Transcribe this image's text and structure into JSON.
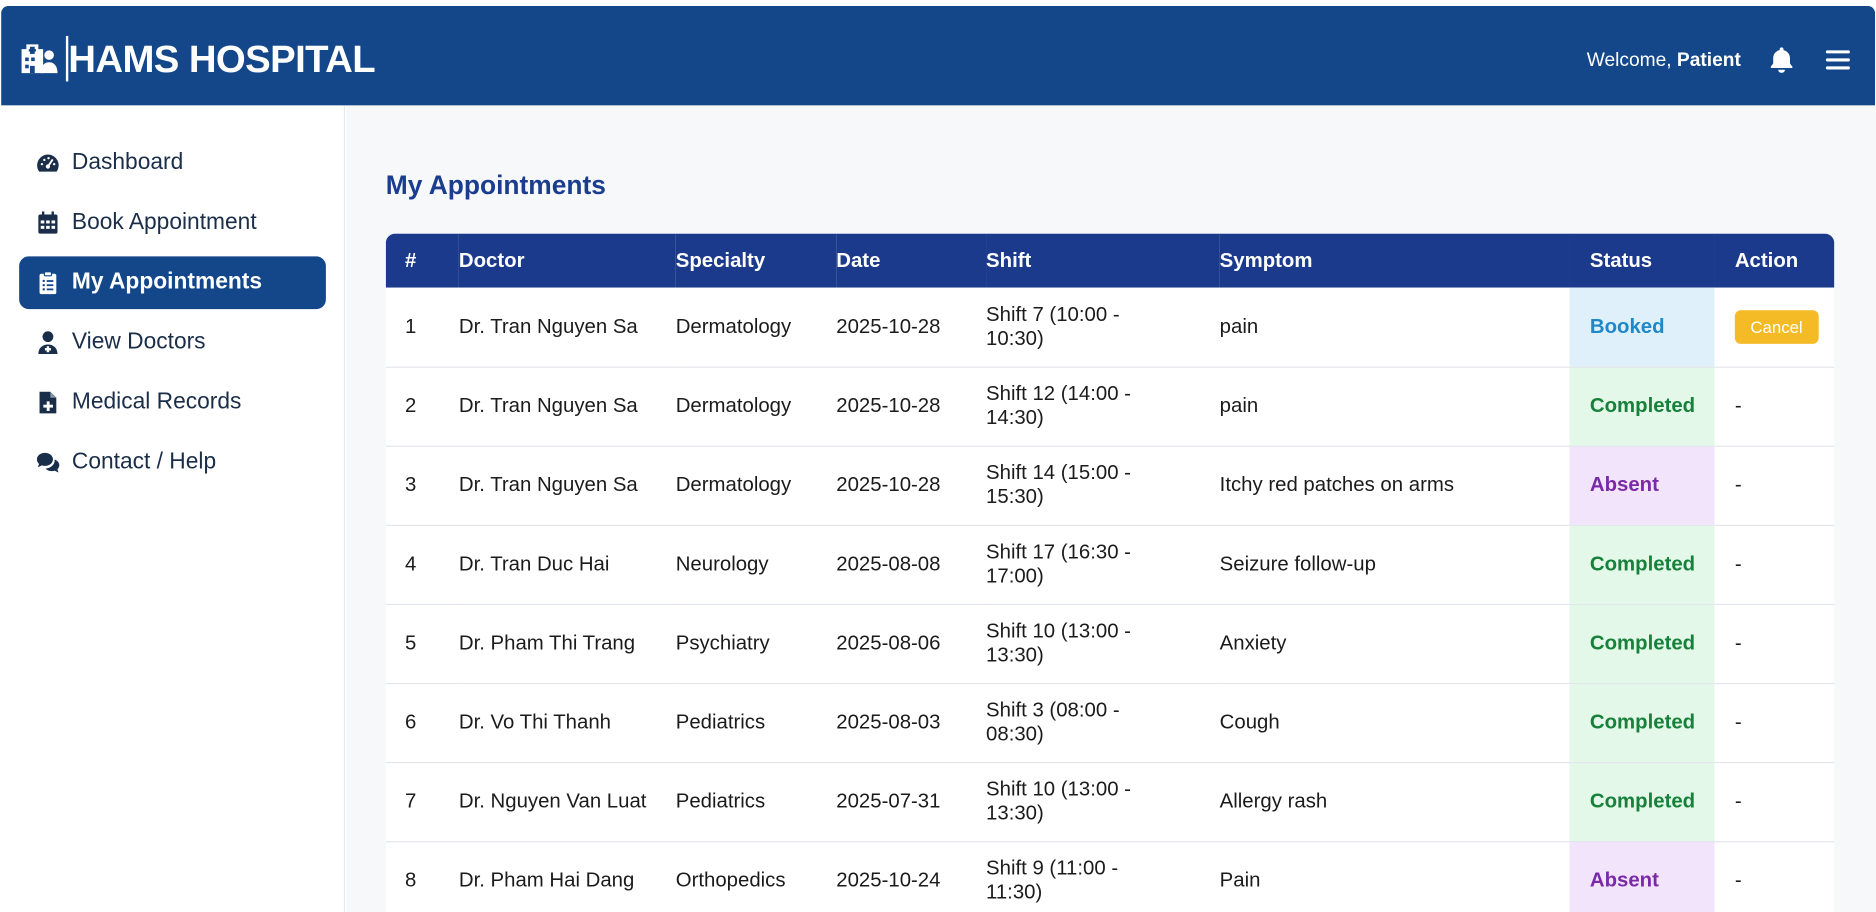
{
  "header": {
    "brand": "HAMS HOSPITAL",
    "brand_icon": "hospital-user-icon",
    "welcome_prefix": "Welcome,",
    "user_role": "Patient",
    "bell_icon": "bell-icon",
    "menu_icon": "hamburger-menu-icon",
    "bg_color": "#13478a"
  },
  "sidebar": {
    "items": [
      {
        "label": "Dashboard",
        "icon": "gauge-icon"
      },
      {
        "label": "Book Appointment",
        "icon": "calendar-icon"
      },
      {
        "label": "My Appointments",
        "icon": "clipboard-list-icon",
        "active": true
      },
      {
        "label": "View Doctors",
        "icon": "user-doctor-icon"
      },
      {
        "label": "Medical Records",
        "icon": "file-medical-icon"
      },
      {
        "label": "Contact / Help",
        "icon": "comments-icon"
      }
    ]
  },
  "main": {
    "title": "My Appointments",
    "columns": [
      "#",
      "Doctor",
      "Specialty",
      "Date",
      "Shift",
      "Symptom",
      "Status",
      "Action"
    ],
    "rows": [
      {
        "num": "1",
        "doctor": "Dr. Tran Nguyen Sa",
        "specialty": "Dermatology",
        "date": "2025-10-28",
        "shift": "Shift 7 (10:00 - 10:30)",
        "symptom": "pain",
        "status": "Booked",
        "action": "Cancel"
      },
      {
        "num": "2",
        "doctor": "Dr. Tran Nguyen Sa",
        "specialty": "Dermatology",
        "date": "2025-10-28",
        "shift": "Shift 12 (14:00 - 14:30)",
        "symptom": "pain",
        "status": "Completed",
        "action": "-"
      },
      {
        "num": "3",
        "doctor": "Dr. Tran Nguyen Sa",
        "specialty": "Dermatology",
        "date": "2025-10-28",
        "shift": "Shift 14 (15:00 - 15:30)",
        "symptom": "Itchy red patches on arms",
        "status": "Absent",
        "action": "-"
      },
      {
        "num": "4",
        "doctor": "Dr. Tran Duc Hai",
        "specialty": "Neurology",
        "date": "2025-08-08",
        "shift": "Shift 17 (16:30 - 17:00)",
        "symptom": "Seizure follow-up",
        "status": "Completed",
        "action": "-"
      },
      {
        "num": "5",
        "doctor": "Dr. Pham Thi Trang",
        "specialty": "Psychiatry",
        "date": "2025-08-06",
        "shift": "Shift 10 (13:00 - 13:30)",
        "symptom": "Anxiety",
        "status": "Completed",
        "action": "-"
      },
      {
        "num": "6",
        "doctor": "Dr. Vo Thi Thanh",
        "specialty": "Pediatrics",
        "date": "2025-08-03",
        "shift": "Shift 3 (08:00 - 08:30)",
        "symptom": "Cough",
        "status": "Completed",
        "action": "-"
      },
      {
        "num": "7",
        "doctor": "Dr. Nguyen Van Luat",
        "specialty": "Pediatrics",
        "date": "2025-07-31",
        "shift": "Shift 10 (13:00 - 13:30)",
        "symptom": "Allergy rash",
        "status": "Completed",
        "action": "-"
      },
      {
        "num": "8",
        "doctor": "Dr. Pham Hai Dang",
        "specialty": "Orthopedics",
        "date": "2025-10-24",
        "shift": "Shift 9 (11:00 - 11:30)",
        "symptom": "Pain",
        "status": "Absent",
        "action": "-"
      }
    ]
  },
  "colors": {
    "accent": "#13478a",
    "table_header": "#1c3a8c",
    "title": "#1a3d8f",
    "booked_text": "#1e88c9",
    "completed_text": "#17803a",
    "absent_text": "#7a2aa8",
    "cancel_button": "#f5bb27"
  }
}
